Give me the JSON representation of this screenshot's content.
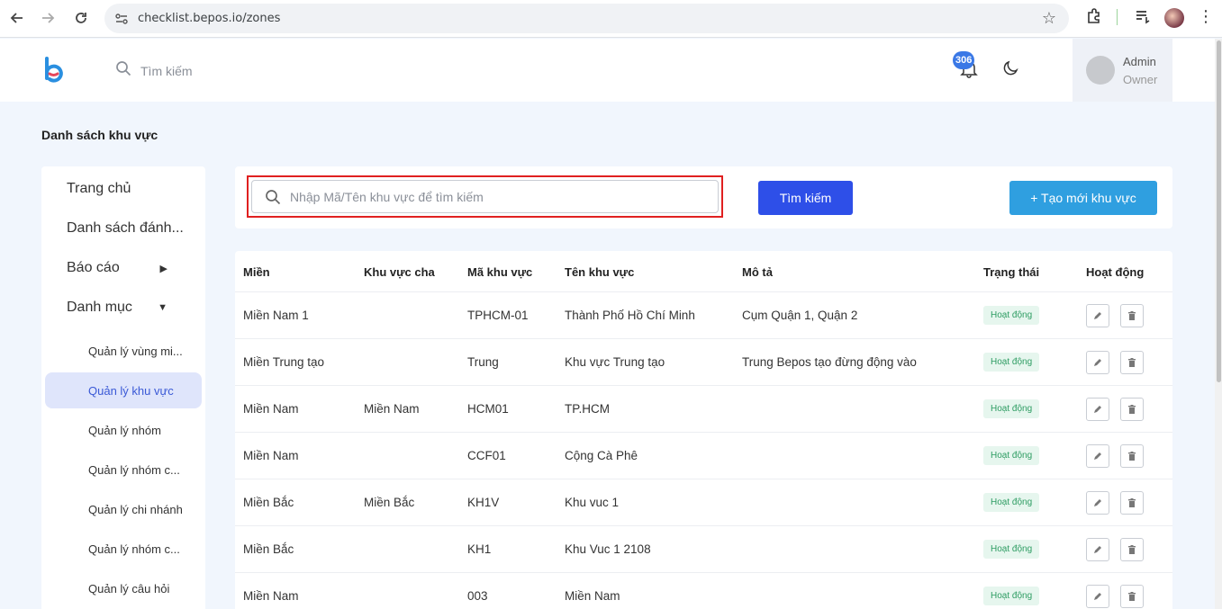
{
  "browser": {
    "url": "checklist.bepos.io/zones"
  },
  "header": {
    "search_placeholder": "Tìm kiếm",
    "notification_count": "306",
    "user_name": "Admin",
    "user_role": "Owner"
  },
  "page": {
    "title": "Danh sách khu vực"
  },
  "sidebar": {
    "items": [
      {
        "label": "Trang chủ"
      },
      {
        "label": "Danh sách đánh..."
      },
      {
        "label": "Báo cáo"
      },
      {
        "label": "Danh mục"
      }
    ],
    "sub_items": [
      {
        "label": "Quản lý vùng mi..."
      },
      {
        "label": "Quản lý khu vực"
      },
      {
        "label": "Quản lý nhóm"
      },
      {
        "label": "Quản lý nhóm c..."
      },
      {
        "label": "Quản lý chi nhánh"
      },
      {
        "label": "Quản lý nhóm c..."
      },
      {
        "label": "Quản lý câu hỏi"
      }
    ]
  },
  "search": {
    "placeholder": "Nhập Mã/Tên khu vực để tìm kiếm",
    "value": "",
    "search_button": "Tìm kiếm",
    "create_button": "+ Tạo mới khu vực"
  },
  "table": {
    "columns": [
      "Miền",
      "Khu vực cha",
      "Mã khu vực",
      "Tên khu vực",
      "Mô tả",
      "Trạng thái",
      "Hoạt động"
    ],
    "rows": [
      {
        "mien": "Miền Nam 1",
        "parent": "",
        "code": "TPHCM-01",
        "name": "Thành Phố Hồ Chí Minh",
        "desc": "Cụm Quận 1, Quận 2",
        "status": "Hoạt động"
      },
      {
        "mien": "Miền Trung tạo",
        "parent": "",
        "code": "Trung",
        "name": "Khu vực Trung tạo",
        "desc": "Trung Bepos tạo đừng động vào",
        "status": "Hoạt động"
      },
      {
        "mien": "Miền Nam",
        "parent": "Miền Nam",
        "code": "HCM01",
        "name": "TP.HCM",
        "desc": "",
        "status": "Hoạt động"
      },
      {
        "mien": "Miền Nam",
        "parent": "",
        "code": "CCF01",
        "name": "Cộng Cà Phê",
        "desc": "",
        "status": "Hoạt động"
      },
      {
        "mien": "Miền Bắc",
        "parent": "Miền Bắc",
        "code": "KH1V",
        "name": "Khu vuc 1",
        "desc": "",
        "status": "Hoạt động"
      },
      {
        "mien": "Miền Bắc",
        "parent": "",
        "code": "KH1",
        "name": "Khu Vuc 1 2108",
        "desc": "",
        "status": "Hoạt động"
      },
      {
        "mien": "Miền Nam",
        "parent": "",
        "code": "003",
        "name": "Miền Nam",
        "desc": "",
        "status": "Hoạt động"
      }
    ]
  },
  "colors": {
    "primary": "#2e4fe8",
    "create": "#2f9fe0",
    "status_bg": "#e6f6ee",
    "status_text": "#2d9c62",
    "highlight": "#e02020"
  }
}
